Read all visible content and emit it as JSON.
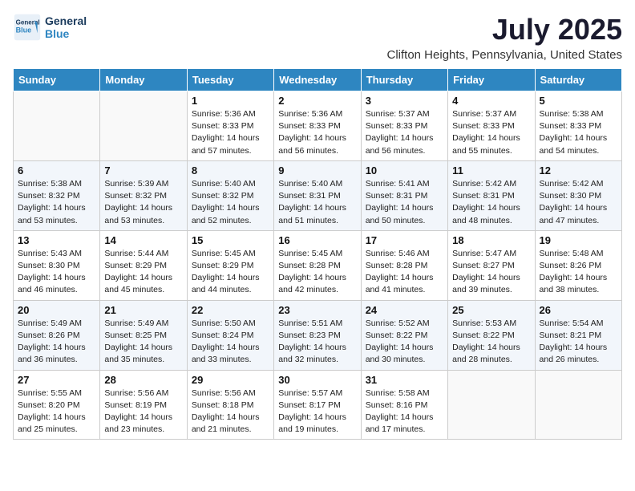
{
  "header": {
    "logo_line1": "General",
    "logo_line2": "Blue",
    "month": "July 2025",
    "location": "Clifton Heights, Pennsylvania, United States"
  },
  "weekdays": [
    "Sunday",
    "Monday",
    "Tuesday",
    "Wednesday",
    "Thursday",
    "Friday",
    "Saturday"
  ],
  "weeks": [
    [
      {
        "day": "",
        "sunrise": "",
        "sunset": "",
        "daylight": ""
      },
      {
        "day": "",
        "sunrise": "",
        "sunset": "",
        "daylight": ""
      },
      {
        "day": "1",
        "sunrise": "Sunrise: 5:36 AM",
        "sunset": "Sunset: 8:33 PM",
        "daylight": "Daylight: 14 hours and 57 minutes."
      },
      {
        "day": "2",
        "sunrise": "Sunrise: 5:36 AM",
        "sunset": "Sunset: 8:33 PM",
        "daylight": "Daylight: 14 hours and 56 minutes."
      },
      {
        "day": "3",
        "sunrise": "Sunrise: 5:37 AM",
        "sunset": "Sunset: 8:33 PM",
        "daylight": "Daylight: 14 hours and 56 minutes."
      },
      {
        "day": "4",
        "sunrise": "Sunrise: 5:37 AM",
        "sunset": "Sunset: 8:33 PM",
        "daylight": "Daylight: 14 hours and 55 minutes."
      },
      {
        "day": "5",
        "sunrise": "Sunrise: 5:38 AM",
        "sunset": "Sunset: 8:33 PM",
        "daylight": "Daylight: 14 hours and 54 minutes."
      }
    ],
    [
      {
        "day": "6",
        "sunrise": "Sunrise: 5:38 AM",
        "sunset": "Sunset: 8:32 PM",
        "daylight": "Daylight: 14 hours and 53 minutes."
      },
      {
        "day": "7",
        "sunrise": "Sunrise: 5:39 AM",
        "sunset": "Sunset: 8:32 PM",
        "daylight": "Daylight: 14 hours and 53 minutes."
      },
      {
        "day": "8",
        "sunrise": "Sunrise: 5:40 AM",
        "sunset": "Sunset: 8:32 PM",
        "daylight": "Daylight: 14 hours and 52 minutes."
      },
      {
        "day": "9",
        "sunrise": "Sunrise: 5:40 AM",
        "sunset": "Sunset: 8:31 PM",
        "daylight": "Daylight: 14 hours and 51 minutes."
      },
      {
        "day": "10",
        "sunrise": "Sunrise: 5:41 AM",
        "sunset": "Sunset: 8:31 PM",
        "daylight": "Daylight: 14 hours and 50 minutes."
      },
      {
        "day": "11",
        "sunrise": "Sunrise: 5:42 AM",
        "sunset": "Sunset: 8:31 PM",
        "daylight": "Daylight: 14 hours and 48 minutes."
      },
      {
        "day": "12",
        "sunrise": "Sunrise: 5:42 AM",
        "sunset": "Sunset: 8:30 PM",
        "daylight": "Daylight: 14 hours and 47 minutes."
      }
    ],
    [
      {
        "day": "13",
        "sunrise": "Sunrise: 5:43 AM",
        "sunset": "Sunset: 8:30 PM",
        "daylight": "Daylight: 14 hours and 46 minutes."
      },
      {
        "day": "14",
        "sunrise": "Sunrise: 5:44 AM",
        "sunset": "Sunset: 8:29 PM",
        "daylight": "Daylight: 14 hours and 45 minutes."
      },
      {
        "day": "15",
        "sunrise": "Sunrise: 5:45 AM",
        "sunset": "Sunset: 8:29 PM",
        "daylight": "Daylight: 14 hours and 44 minutes."
      },
      {
        "day": "16",
        "sunrise": "Sunrise: 5:45 AM",
        "sunset": "Sunset: 8:28 PM",
        "daylight": "Daylight: 14 hours and 42 minutes."
      },
      {
        "day": "17",
        "sunrise": "Sunrise: 5:46 AM",
        "sunset": "Sunset: 8:28 PM",
        "daylight": "Daylight: 14 hours and 41 minutes."
      },
      {
        "day": "18",
        "sunrise": "Sunrise: 5:47 AM",
        "sunset": "Sunset: 8:27 PM",
        "daylight": "Daylight: 14 hours and 39 minutes."
      },
      {
        "day": "19",
        "sunrise": "Sunrise: 5:48 AM",
        "sunset": "Sunset: 8:26 PM",
        "daylight": "Daylight: 14 hours and 38 minutes."
      }
    ],
    [
      {
        "day": "20",
        "sunrise": "Sunrise: 5:49 AM",
        "sunset": "Sunset: 8:26 PM",
        "daylight": "Daylight: 14 hours and 36 minutes."
      },
      {
        "day": "21",
        "sunrise": "Sunrise: 5:49 AM",
        "sunset": "Sunset: 8:25 PM",
        "daylight": "Daylight: 14 hours and 35 minutes."
      },
      {
        "day": "22",
        "sunrise": "Sunrise: 5:50 AM",
        "sunset": "Sunset: 8:24 PM",
        "daylight": "Daylight: 14 hours and 33 minutes."
      },
      {
        "day": "23",
        "sunrise": "Sunrise: 5:51 AM",
        "sunset": "Sunset: 8:23 PM",
        "daylight": "Daylight: 14 hours and 32 minutes."
      },
      {
        "day": "24",
        "sunrise": "Sunrise: 5:52 AM",
        "sunset": "Sunset: 8:22 PM",
        "daylight": "Daylight: 14 hours and 30 minutes."
      },
      {
        "day": "25",
        "sunrise": "Sunrise: 5:53 AM",
        "sunset": "Sunset: 8:22 PM",
        "daylight": "Daylight: 14 hours and 28 minutes."
      },
      {
        "day": "26",
        "sunrise": "Sunrise: 5:54 AM",
        "sunset": "Sunset: 8:21 PM",
        "daylight": "Daylight: 14 hours and 26 minutes."
      }
    ],
    [
      {
        "day": "27",
        "sunrise": "Sunrise: 5:55 AM",
        "sunset": "Sunset: 8:20 PM",
        "daylight": "Daylight: 14 hours and 25 minutes."
      },
      {
        "day": "28",
        "sunrise": "Sunrise: 5:56 AM",
        "sunset": "Sunset: 8:19 PM",
        "daylight": "Daylight: 14 hours and 23 minutes."
      },
      {
        "day": "29",
        "sunrise": "Sunrise: 5:56 AM",
        "sunset": "Sunset: 8:18 PM",
        "daylight": "Daylight: 14 hours and 21 minutes."
      },
      {
        "day": "30",
        "sunrise": "Sunrise: 5:57 AM",
        "sunset": "Sunset: 8:17 PM",
        "daylight": "Daylight: 14 hours and 19 minutes."
      },
      {
        "day": "31",
        "sunrise": "Sunrise: 5:58 AM",
        "sunset": "Sunset: 8:16 PM",
        "daylight": "Daylight: 14 hours and 17 minutes."
      },
      {
        "day": "",
        "sunrise": "",
        "sunset": "",
        "daylight": ""
      },
      {
        "day": "",
        "sunrise": "",
        "sunset": "",
        "daylight": ""
      }
    ]
  ]
}
